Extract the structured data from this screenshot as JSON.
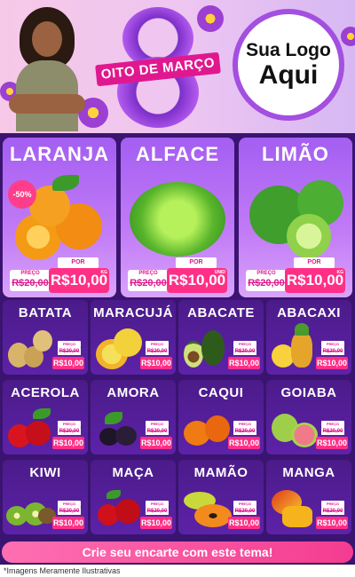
{
  "header": {
    "ribbon_text": "OITO DE MARÇO",
    "big_number": "8",
    "logo_line1": "Sua Logo",
    "logo_line2": "Aqui"
  },
  "featured": [
    {
      "name": "LARANJA",
      "badge": "-50%",
      "price_label": "PREÇO",
      "por_label": "POR",
      "old_price": "R$20,00",
      "new_price": "R$10,00",
      "unit": "KG"
    },
    {
      "name": "ALFACE",
      "price_label": "PREÇO",
      "por_label": "POR",
      "old_price": "R$20,00",
      "new_price": "R$10,00",
      "unit": "UNID"
    },
    {
      "name": "LIMÃO",
      "price_label": "PREÇO",
      "por_label": "POR",
      "old_price": "R$20,00",
      "new_price": "R$10,00",
      "unit": "KG"
    }
  ],
  "products": [
    {
      "name": "BATATA",
      "price_label": "PREÇO",
      "old_price": "R$20,00",
      "new_price": "R$10,00"
    },
    {
      "name": "MARACUJÁ",
      "price_label": "PREÇO",
      "old_price": "R$20,00",
      "new_price": "R$10,00"
    },
    {
      "name": "ABACATE",
      "price_label": "PREÇO",
      "old_price": "R$20,00",
      "new_price": "R$10,00"
    },
    {
      "name": "ABACAXI",
      "price_label": "PREÇO",
      "old_price": "R$20,00",
      "new_price": "R$10,00"
    },
    {
      "name": "ACEROLA",
      "price_label": "PREÇO",
      "old_price": "R$20,00",
      "new_price": "R$10,00"
    },
    {
      "name": "AMORA",
      "price_label": "PREÇO",
      "old_price": "R$20,00",
      "new_price": "R$10,00"
    },
    {
      "name": "CAQUI",
      "price_label": "PREÇO",
      "old_price": "R$20,00",
      "new_price": "R$10,00"
    },
    {
      "name": "GOIABA",
      "price_label": "PREÇO",
      "old_price": "R$20,00",
      "new_price": "R$10,00"
    },
    {
      "name": "KIWI",
      "price_label": "PREÇO",
      "old_price": "R$20,00",
      "new_price": "R$10,00"
    },
    {
      "name": "MAÇA",
      "price_label": "PREÇO",
      "old_price": "R$20,00",
      "new_price": "R$10,00"
    },
    {
      "name": "MAMÃO",
      "price_label": "PREÇO",
      "old_price": "R$20,00",
      "new_price": "R$10,00"
    },
    {
      "name": "MANGA",
      "price_label": "PREÇO",
      "old_price": "R$20,00",
      "new_price": "R$10,00"
    }
  ],
  "footer": {
    "cta": "Crie seu encarte com este tema!",
    "disclaimer": "*Imagens Meramente Ilustrativas"
  },
  "colors": {
    "accent_pink": "#ff2f86",
    "purple_dark": "#3a1470",
    "purple_light": "#a45ef2"
  }
}
